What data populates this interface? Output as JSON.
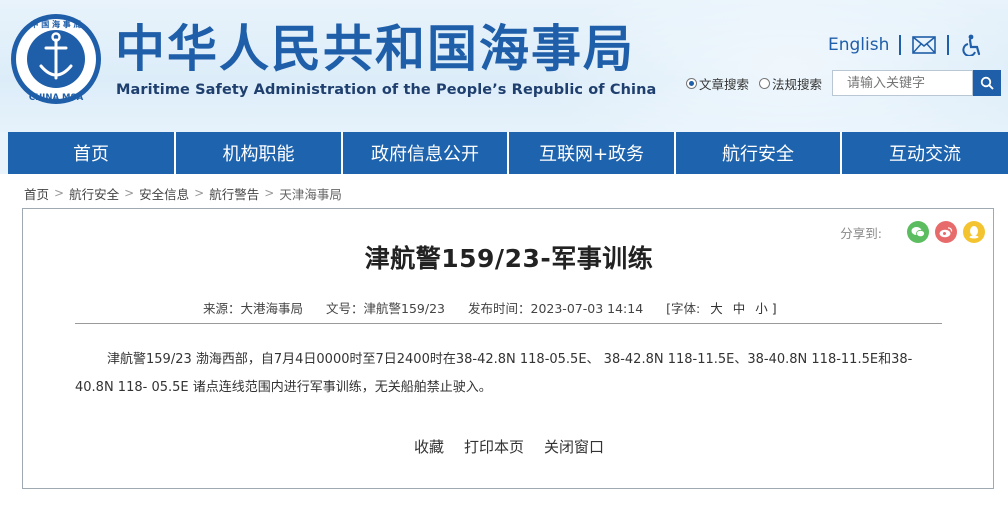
{
  "header": {
    "title_cn": "中华人民共和国海事局",
    "title_en": "Maritime Safety Administration of the People’s Republic of China",
    "logo_text_top": "中 国 海 事 局",
    "logo_text_bottom": "CHINA MSA",
    "english_link": "English",
    "search": {
      "option_article": "文章搜索",
      "option_law": "法规搜索",
      "selected": "文章搜索",
      "placeholder": "请输入关键字"
    }
  },
  "nav": {
    "items": [
      {
        "label": "首页"
      },
      {
        "label": "机构职能"
      },
      {
        "label": "政府信息公开"
      },
      {
        "label": "互联网+政务"
      },
      {
        "label": "航行安全"
      },
      {
        "label": "互动交流"
      }
    ]
  },
  "breadcrumb": {
    "items": [
      "首页",
      "航行安全",
      "安全信息",
      "航行警告",
      "天津海事局"
    ],
    "separator": ">"
  },
  "article": {
    "share_label": "分享到:",
    "title": "津航警159/23-军事训练",
    "source": "来源：大港海事局",
    "doc_no": "文号：津航警159/23",
    "publish_time": "发布时间：2023-07-03 14:14",
    "font_label": "[字体:",
    "font_large": "大",
    "font_medium": "中",
    "font_small": "小 ]",
    "body": "津航警159/23 渤海西部，自7月4日0000时至7日2400时在38-42.8N 118-05.5E、 38-42.8N 118-11.5E、38-40.8N 118-11.5E和38-40.8N 118- 05.5E 诸点连线范围内进行军事训练，无关船舶禁止驶入。",
    "actions": {
      "favorite": "收藏",
      "print": "打印本页",
      "close": "关闭窗口"
    }
  },
  "colors": {
    "brand_blue": "#1e63ad",
    "title_blue": "#1f5ea8",
    "header_bg": "#e8f3fb"
  }
}
